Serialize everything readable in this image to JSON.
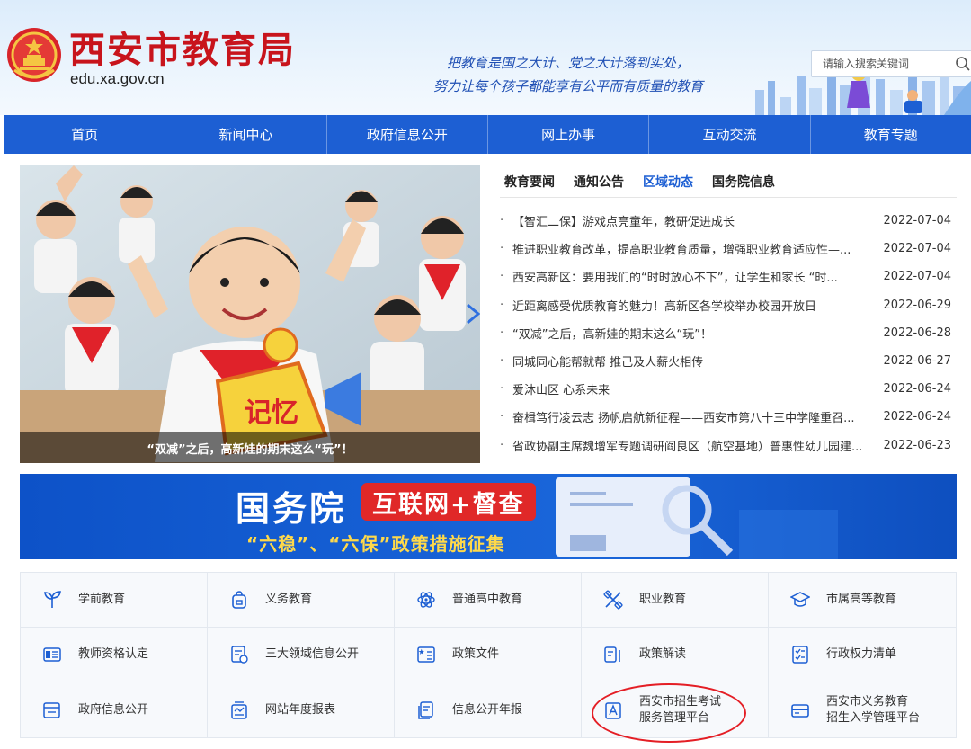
{
  "header": {
    "title": "西安市教育局",
    "domain": "edu.xa.gov.cn",
    "slogan_line1": "把教育是国之大计、党之大计落到实处，",
    "slogan_line2": "努力让每个孩子都能享有公平而有质量的教育",
    "search_placeholder": "请输入搜索关键词"
  },
  "nav": [
    {
      "label": "首页"
    },
    {
      "label": "新闻中心"
    },
    {
      "label": "政府信息公开"
    },
    {
      "label": "网上办事"
    },
    {
      "label": "互动交流"
    },
    {
      "label": "教育专题"
    }
  ],
  "hero": {
    "caption": "“双减”之后，高新娃的期末这么“玩”！"
  },
  "news": {
    "tabs": [
      {
        "label": "教育要闻",
        "active": false
      },
      {
        "label": "通知公告",
        "active": false
      },
      {
        "label": "区域动态",
        "active": true
      },
      {
        "label": "国务院信息",
        "active": false
      }
    ],
    "items": [
      {
        "title": "【智汇二保】游戏点亮童年，教研促进成长",
        "date": "2022-07-04"
      },
      {
        "title": "推进职业教育改革，提高职业教育质量，增强职业教育适应性—...",
        "date": "2022-07-04"
      },
      {
        "title": "西安高新区：要用我们的“时时放心不下”，让学生和家长 “时...",
        "date": "2022-07-04"
      },
      {
        "title": "近距离感受优质教育的魅力！高新区各学校举办校园开放日",
        "date": "2022-06-29"
      },
      {
        "title": "“双减”之后，高新娃的期末这么“玩”！",
        "date": "2022-06-28"
      },
      {
        "title": "同城同心能帮就帮 推己及人薪火相传",
        "date": "2022-06-27"
      },
      {
        "title": "爱沐山区 心系未来",
        "date": "2022-06-24"
      },
      {
        "title": "奋楫笃行凌云志 扬帆启航新征程——西安市第八十三中学隆重召...",
        "date": "2022-06-24"
      },
      {
        "title": "省政协副主席魏增军专题调研阎良区（航空基地）普惠性幼儿园建...",
        "date": "2022-06-23"
      }
    ]
  },
  "banner": {
    "title": "国务院",
    "pill": "互联网+督查",
    "subtitle": "“六稳”、“六保”政策措施征集"
  },
  "services": [
    {
      "label": "学前教育",
      "icon": "sprout-icon"
    },
    {
      "label": "义务教育",
      "icon": "backpack-icon"
    },
    {
      "label": "普通高中教育",
      "icon": "atom-icon"
    },
    {
      "label": "职业教育",
      "icon": "tools-icon"
    },
    {
      "label": "市属高等教育",
      "icon": "graduation-cap-icon"
    },
    {
      "label": "教师资格认定",
      "icon": "certificate-icon"
    },
    {
      "label": "三大领域信息公开",
      "icon": "document-list-icon"
    },
    {
      "label": "政策文件",
      "icon": "policy-book-icon"
    },
    {
      "label": "政策解读",
      "icon": "reading-icon"
    },
    {
      "label": "行政权力清单",
      "icon": "checklist-icon"
    },
    {
      "label": "政府信息公开",
      "icon": "window-icon"
    },
    {
      "label": "网站年度报表",
      "icon": "report-icon"
    },
    {
      "label": "信息公开年报",
      "icon": "annual-report-icon"
    },
    {
      "label": "西安市招生考试\n服务管理平台",
      "icon": "exam-platform-icon"
    },
    {
      "label": "西安市义务教育\n招生入学管理平台",
      "icon": "enrollment-platform-icon"
    }
  ],
  "colors": {
    "brand_red": "#c8141c",
    "nav_blue": "#1d5fd3",
    "active_tab": "#1d5fd3",
    "highlight_red": "#e41e25"
  }
}
